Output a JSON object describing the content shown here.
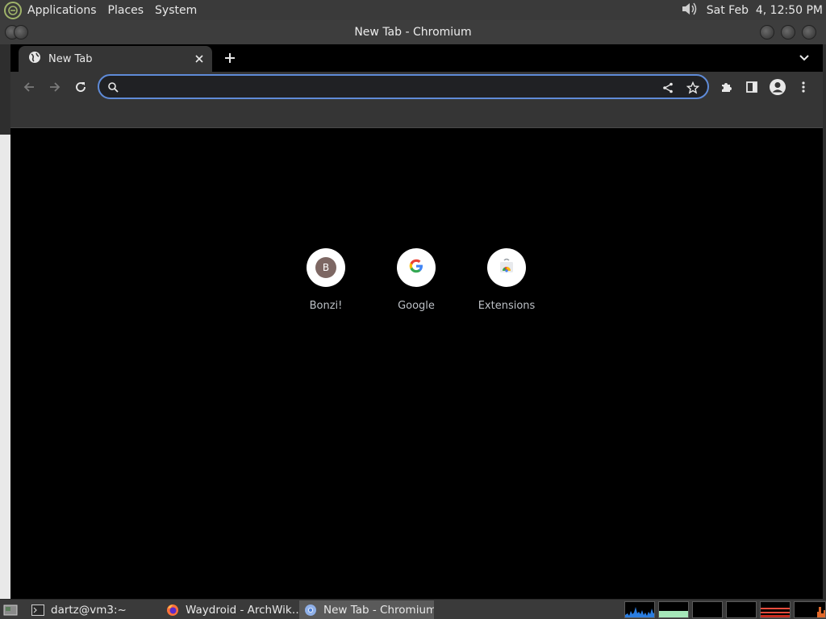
{
  "top_panel": {
    "menus": [
      "Applications",
      "Places",
      "System"
    ],
    "clock": "Sat Feb  4, 12:50 PM"
  },
  "window": {
    "title": "New Tab - Chromium"
  },
  "browser": {
    "tab": {
      "title": "New Tab"
    },
    "omnibox": {
      "value": ""
    },
    "shortcuts": [
      {
        "label": "Bonzi!",
        "initial": "B"
      },
      {
        "label": "Google"
      },
      {
        "label": "Extensions"
      }
    ]
  },
  "taskbar": {
    "tasks": [
      {
        "label": "dartz@vm3:~",
        "icon": "terminal-icon",
        "active": false
      },
      {
        "label": "Waydroid - ArchWik…",
        "icon": "firefox-icon",
        "active": false
      },
      {
        "label": "New Tab - Chromium",
        "icon": "chromium-icon",
        "active": true
      }
    ]
  },
  "colors": {
    "panel": "#3a3a3a",
    "browser_toolbar": "#353535",
    "content_bg": "#000000",
    "omnibox_border": "#5f8bd8"
  }
}
